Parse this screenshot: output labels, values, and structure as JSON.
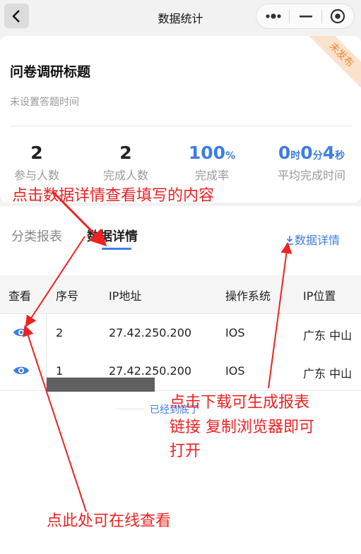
{
  "nav": {
    "title": "数据统计"
  },
  "survey": {
    "status_badge": "未发布",
    "title": "问卷调研标题",
    "time_text": "未设置答题时间"
  },
  "stats": {
    "participants": {
      "value": "2",
      "label": "参与人数"
    },
    "completed": {
      "value": "2",
      "label": "完成人数"
    },
    "rate": {
      "value": "100",
      "unit": "%",
      "label": "完成率"
    },
    "avg_time": {
      "h": "0",
      "h_unit": "时",
      "m": "0",
      "m_unit": "分",
      "s": "4",
      "s_unit": "秒",
      "label": "平均完成时间"
    }
  },
  "tabs": {
    "category": "分类报表",
    "detail": "数据详情"
  },
  "download": {
    "label": "数据详情"
  },
  "table": {
    "headers": [
      "查看",
      "序号",
      "IP地址",
      "操作系统",
      "IP位置"
    ],
    "rows": [
      {
        "index": "2",
        "ip": "27.42.250.200",
        "os": "IOS",
        "location": "广东 中山"
      },
      {
        "index": "1",
        "ip": "27.42.250.200",
        "os": "IOS",
        "location": "广东 中山"
      }
    ]
  },
  "end_text": "已经到底了",
  "annotations": {
    "detail_hint": "点击数据详情查看填写的内容",
    "download_hint_1": "点击下载可生成报表",
    "download_hint_2": "链接 复制浏览器即可",
    "download_hint_3": "打开",
    "view_hint": "点此处可在线查看"
  },
  "colors": {
    "accent": "#3c7de6",
    "annotation": "#ee2222",
    "badge_bg": "#fbe2cc",
    "badge_text": "#f08a2e"
  }
}
